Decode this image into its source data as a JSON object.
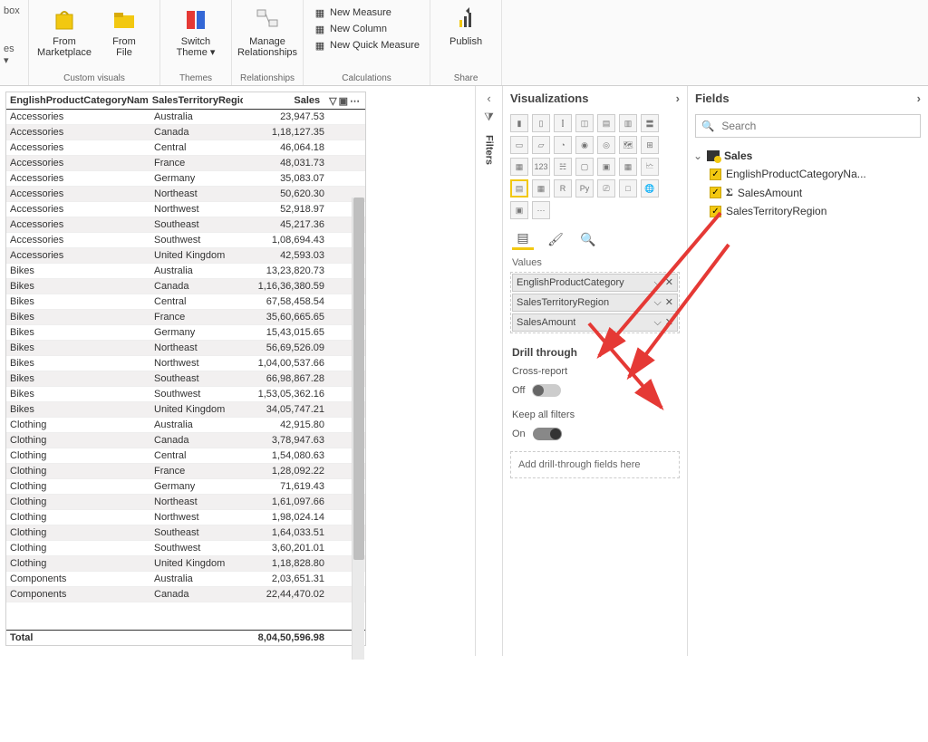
{
  "ribbon": {
    "groups": [
      {
        "title": "Custom visuals",
        "big": [
          {
            "label": "From\nMarketplace",
            "icon": "bag"
          },
          {
            "label": "From\nFile",
            "icon": "folder"
          }
        ]
      },
      {
        "title": "Themes",
        "big": [
          {
            "label": "Switch\nTheme ▾",
            "icon": "theme"
          }
        ]
      },
      {
        "title": "Relationships",
        "big": [
          {
            "label": "Manage\nRelationships",
            "icon": "rel"
          }
        ]
      },
      {
        "title": "Calculations",
        "small": [
          "New Measure",
          "New Column",
          "New Quick Measure"
        ]
      },
      {
        "title": "Share",
        "big": [
          {
            "label": "Publish",
            "icon": "publish"
          }
        ]
      }
    ],
    "partial_left_label": "box",
    "partial_left_dropdown": "es ▾"
  },
  "table": {
    "columns": [
      "EnglishProductCategoryName",
      "SalesTerritoryRegion",
      "Sales"
    ],
    "rows": [
      [
        "Accessories",
        "Australia",
        "23,947.53"
      ],
      [
        "Accessories",
        "Canada",
        "1,18,127.35"
      ],
      [
        "Accessories",
        "Central",
        "46,064.18"
      ],
      [
        "Accessories",
        "France",
        "48,031.73"
      ],
      [
        "Accessories",
        "Germany",
        "35,083.07"
      ],
      [
        "Accessories",
        "Northeast",
        "50,620.30"
      ],
      [
        "Accessories",
        "Northwest",
        "52,918.97"
      ],
      [
        "Accessories",
        "Southeast",
        "45,217.36"
      ],
      [
        "Accessories",
        "Southwest",
        "1,08,694.43"
      ],
      [
        "Accessories",
        "United Kingdom",
        "42,593.03"
      ],
      [
        "Bikes",
        "Australia",
        "13,23,820.73"
      ],
      [
        "Bikes",
        "Canada",
        "1,16,36,380.59"
      ],
      [
        "Bikes",
        "Central",
        "67,58,458.54"
      ],
      [
        "Bikes",
        "France",
        "35,60,665.65"
      ],
      [
        "Bikes",
        "Germany",
        "15,43,015.65"
      ],
      [
        "Bikes",
        "Northeast",
        "56,69,526.09"
      ],
      [
        "Bikes",
        "Northwest",
        "1,04,00,537.66"
      ],
      [
        "Bikes",
        "Southeast",
        "66,98,867.28"
      ],
      [
        "Bikes",
        "Southwest",
        "1,53,05,362.16"
      ],
      [
        "Bikes",
        "United Kingdom",
        "34,05,747.21"
      ],
      [
        "Clothing",
        "Australia",
        "42,915.80"
      ],
      [
        "Clothing",
        "Canada",
        "3,78,947.63"
      ],
      [
        "Clothing",
        "Central",
        "1,54,080.63"
      ],
      [
        "Clothing",
        "France",
        "1,28,092.22"
      ],
      [
        "Clothing",
        "Germany",
        "71,619.43"
      ],
      [
        "Clothing",
        "Northeast",
        "1,61,097.66"
      ],
      [
        "Clothing",
        "Northwest",
        "1,98,024.14"
      ],
      [
        "Clothing",
        "Southeast",
        "1,64,033.51"
      ],
      [
        "Clothing",
        "Southwest",
        "3,60,201.01"
      ],
      [
        "Clothing",
        "United Kingdom",
        "1,18,828.80"
      ],
      [
        "Components",
        "Australia",
        "2,03,651.31"
      ],
      [
        "Components",
        "Canada",
        "22,44,470.02"
      ]
    ],
    "total_label": "Total",
    "total_value": "8,04,50,596.98"
  },
  "vizPane": {
    "title": "Visualizations",
    "section_values": "Values",
    "wells": [
      "EnglishProductCategory",
      "SalesTerritoryRegion",
      "SalesAmount"
    ],
    "drill_header": "Drill through",
    "cross_report_label": "Cross-report",
    "cross_report_state": "Off",
    "keep_filters_label": "Keep all filters",
    "keep_filters_state": "On",
    "drill_drop": "Add drill-through fields here"
  },
  "filtersTab": {
    "label": "Filters"
  },
  "fieldsPane": {
    "title": "Fields",
    "search_placeholder": "Search",
    "table_name": "Sales",
    "fields": [
      {
        "name": "EnglishProductCategoryNa...",
        "checked": true,
        "sigma": false
      },
      {
        "name": "SalesAmount",
        "checked": true,
        "sigma": true
      },
      {
        "name": "SalesTerritoryRegion",
        "checked": true,
        "sigma": false
      }
    ]
  }
}
